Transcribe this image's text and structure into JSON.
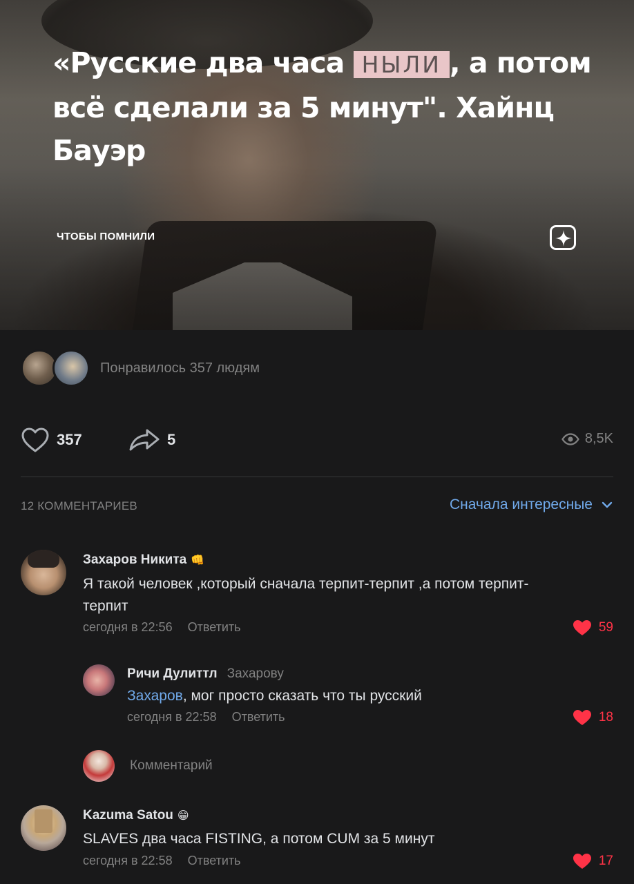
{
  "post": {
    "headline_before": "«Русские два часа ",
    "headline_highlight": "НЫЛИ",
    "headline_after": ", а потом всё сделали за 5 минут\". Хайнц Бауэр",
    "channel": "ЧТОБЫ ПОМНИЛИ"
  },
  "likes_summary": "Понравилось 357 людям",
  "actions": {
    "likes": "357",
    "shares": "5",
    "views": "8,5K"
  },
  "comments_header": {
    "count_label": "12 КОММЕНТАРИЕВ",
    "sort_label": "Сначала интересные"
  },
  "comments": [
    {
      "author": "Захаров Никита",
      "emoji": "👊",
      "text": "Я такой человек ,который сначала терпит-терпит ,а потом терпит-терпит",
      "time": "сегодня в 22:56",
      "reply_label": "Ответить",
      "likes": "59"
    },
    {
      "author": "Ричи Дулиттл",
      "reply_to": "Захарову",
      "mention": "Захаров",
      "text": ", мог просто сказать что ты русский",
      "time": "сегодня в 22:58",
      "reply_label": "Ответить",
      "likes": "18"
    },
    {
      "author": "Kazuma Satou",
      "emoji": "😁",
      "text": "SLAVES два часа FISTING, а потом CUM за 5 минут",
      "time": "сегодня в 22:58",
      "reply_label": "Ответить",
      "likes": "17"
    }
  ],
  "compose": {
    "placeholder": "Комментарий"
  },
  "colors": {
    "background": "#19191a",
    "accent_blue": "#71aaeb",
    "like_red": "#ff3347",
    "secondary_text": "#828282"
  },
  "icons": [
    "zen-star-icon",
    "heart-outline-icon",
    "share-arrow-icon",
    "eye-icon",
    "chevron-down-icon",
    "heart-filled-icon"
  ]
}
